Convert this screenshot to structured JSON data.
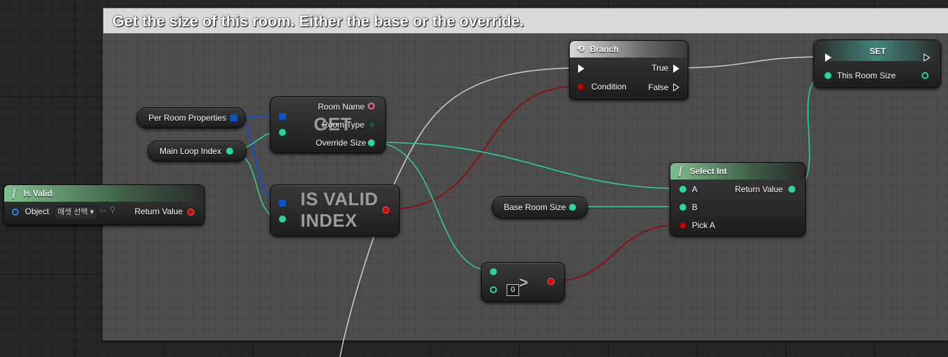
{
  "comment": {
    "title": "Get the size of this room. Either the base or the override."
  },
  "nodes": {
    "is_valid": {
      "title": "Is Valid",
      "icon": "function-icon",
      "object_label": "Object",
      "object_dropdown": "애셋 선택",
      "return_label": "Return Value"
    },
    "per_room_properties": {
      "label": "Per Room Properties"
    },
    "main_loop_index": {
      "label": "Main Loop Index"
    },
    "get": {
      "watermark": "GET",
      "room_name": "Room Name",
      "room_type": "Room Type",
      "override_size": "Override Size"
    },
    "is_valid_index": {
      "watermark_line1": "IS VALID",
      "watermark_line2": "INDEX"
    },
    "branch": {
      "title": "Branch",
      "icon": "branch-icon",
      "true_label": "True",
      "condition_label": "Condition",
      "false_label": "False"
    },
    "set": {
      "title": "SET",
      "var_label": "This Room Size"
    },
    "select_int": {
      "title": "Select Int",
      "icon": "function-icon",
      "a_label": "A",
      "b_label": "B",
      "pick_a_label": "Pick A",
      "return_label": "Return Value"
    },
    "base_room_size": {
      "label": "Base Room Size"
    },
    "greater": {
      "symbol": ">",
      "default_value": "0"
    }
  },
  "colors": {
    "exec_wire": "#d0d0d0",
    "int_wire": "#2bd5a2",
    "bool_wire": "#a00000",
    "array_wire": "#0c4fd0"
  }
}
